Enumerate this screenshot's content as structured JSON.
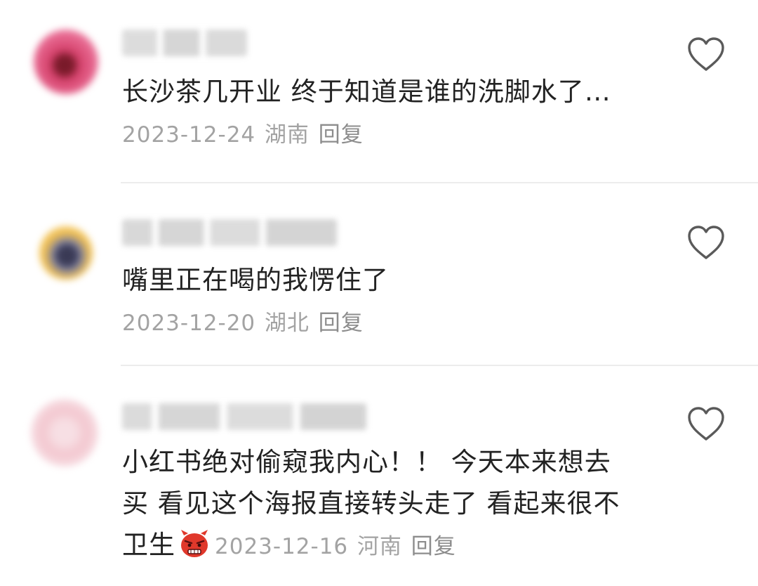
{
  "comments": [
    {
      "text": "长沙茶几开业 终于知道是谁的洗脚水了…",
      "date": "2023-12-24",
      "location": "湖南",
      "reply": "回复",
      "avatar_color": "#d4406a"
    },
    {
      "text": "嘴里正在喝的我愣住了",
      "date": "2023-12-20",
      "location": "湖北",
      "reply": "回复",
      "avatar_color": "#f2c050"
    },
    {
      "text": "小红书绝对偷窥我内心！！ 今天本来想去买 看见这个海报直接转头走了 看起来很不卫生",
      "emoji": "angry-devil-emoji",
      "date": "2023-12-16",
      "location": "河南",
      "reply": "回复",
      "avatar_color": "#f3c7cf"
    }
  ],
  "icons": {
    "like": "heart-outline-icon"
  },
  "colors": {
    "text": "#222222",
    "meta": "#a3a3a3",
    "divider": "#ececec"
  }
}
